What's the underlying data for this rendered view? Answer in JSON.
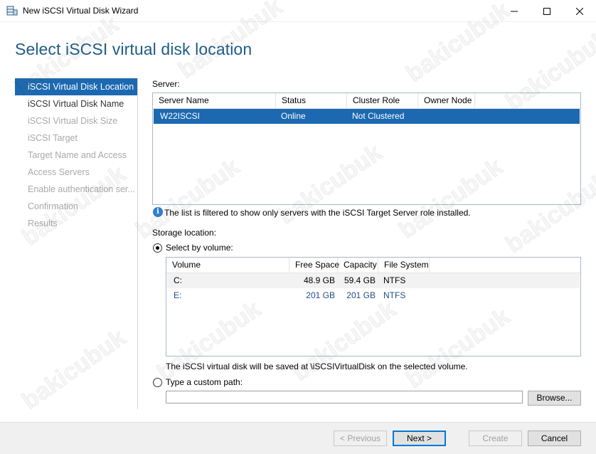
{
  "window": {
    "title": "New iSCSI Virtual Disk Wizard"
  },
  "page": {
    "title": "Select iSCSI virtual disk location"
  },
  "nav": {
    "items": [
      {
        "label": "iSCSI Virtual Disk Location",
        "state": "active"
      },
      {
        "label": "iSCSI Virtual Disk Name",
        "state": "enabled"
      },
      {
        "label": "iSCSI Virtual Disk Size",
        "state": "disabled"
      },
      {
        "label": "iSCSI Target",
        "state": "disabled"
      },
      {
        "label": "Target Name and Access",
        "state": "disabled"
      },
      {
        "label": "Access Servers",
        "state": "disabled"
      },
      {
        "label": "Enable authentication ser...",
        "state": "disabled"
      },
      {
        "label": "Confirmation",
        "state": "disabled"
      },
      {
        "label": "Results",
        "state": "disabled"
      }
    ]
  },
  "server_section": {
    "label": "Server:",
    "columns": [
      "Server Name",
      "Status",
      "Cluster Role",
      "Owner Node"
    ],
    "rows": [
      {
        "name": "W22ISCSI",
        "status": "Online",
        "cluster_role": "Not Clustered",
        "owner_node": ""
      }
    ],
    "info_icon": "info-icon",
    "info_text": "The list is filtered to show only servers with the iSCSI Target Server role installed."
  },
  "storage": {
    "label": "Storage location:",
    "by_volume_label": "Select by volume:",
    "by_volume_selected": true,
    "columns": [
      "Volume",
      "Free Space",
      "Capacity",
      "File System"
    ],
    "rows": [
      {
        "volume": "C:",
        "free": "48.9 GB",
        "capacity": "59.4 GB",
        "fs": "NTFS"
      },
      {
        "volume": "E:",
        "free": "201 GB",
        "capacity": "201 GB",
        "fs": "NTFS"
      }
    ],
    "save_note": "The iSCSI virtual disk will be saved at \\iSCSIVirtualDisk on the selected volume.",
    "custom_path_label": "Type a custom path:",
    "custom_path_value": "",
    "browse_label": "Browse..."
  },
  "buttons": {
    "previous": "< Previous",
    "next": "Next >",
    "create": "Create",
    "cancel": "Cancel"
  },
  "watermark": "bakicubuk",
  "colors": {
    "accent": "#1c69b1",
    "title": "#1e5d86"
  }
}
